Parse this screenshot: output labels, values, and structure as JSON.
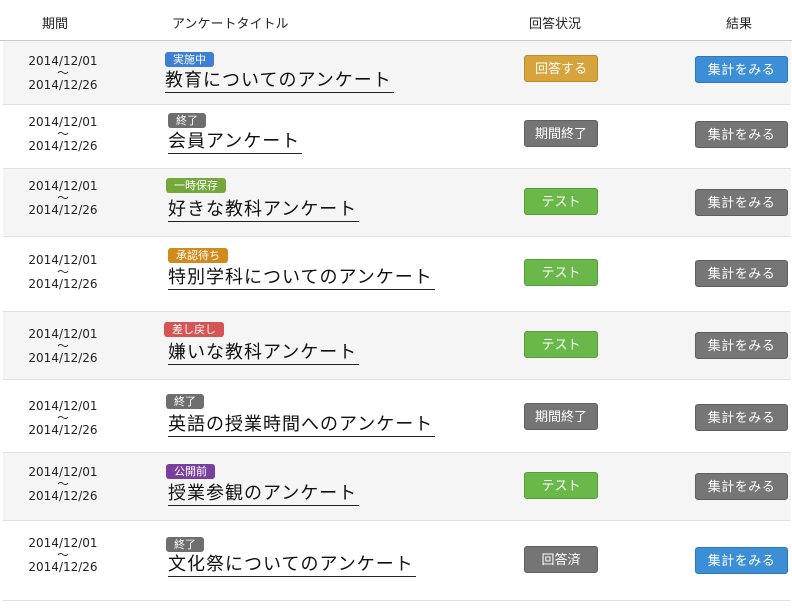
{
  "header": {
    "period": "期間",
    "title": "アンケートタイトル",
    "status": "回答状況",
    "result": "結果"
  },
  "colors": {
    "badge_in_progress": "#3d7fd0",
    "badge_finished": "#6e6e6e",
    "badge_draft": "#74a83a",
    "badge_pending": "#d08a1e",
    "badge_returned": "#d55454",
    "badge_published_before": "#7a3f9e",
    "answer_button": "#d6a33c",
    "test_button": "#6ab84a",
    "closed_button": "#757575",
    "result_active": "#3c8fd6",
    "result_inactive": "#767676"
  },
  "rows": [
    {
      "start": "2014/12/01",
      "tilde": "〜",
      "end": "2014/12/26",
      "badge": "実施中",
      "badge_color": "badge_in_progress",
      "title": "教育についてのアンケート",
      "status": "回答する",
      "status_style": "orange",
      "result": "集計をみる",
      "result_style": "blue"
    },
    {
      "start": "2014/12/01",
      "tilde": "〜",
      "end": "2014/12/26",
      "badge": "終了",
      "badge_color": "badge_finished",
      "title": "会員アンケート",
      "status": "期間終了",
      "status_style": "gray",
      "result": "集計をみる",
      "result_style": "gray"
    },
    {
      "start": "2014/12/01",
      "tilde": "〜",
      "end": "2014/12/26",
      "badge": "一時保存",
      "badge_color": "badge_draft",
      "title": "好きな教科アンケート",
      "status": "テスト",
      "status_style": "green",
      "result": "集計をみる",
      "result_style": "gray"
    },
    {
      "start": "2014/12/01",
      "tilde": "〜",
      "end": "2014/12/26",
      "badge": "承認待ち",
      "badge_color": "badge_pending",
      "title": "特別学科についてのアンケート",
      "status": "テスト",
      "status_style": "green",
      "result": "集計をみる",
      "result_style": "gray"
    },
    {
      "start": "2014/12/01",
      "tilde": "〜",
      "end": "2014/12/26",
      "badge": "差し戻し",
      "badge_color": "badge_returned",
      "title": "嫌いな教科アンケート",
      "status": "テスト",
      "status_style": "green",
      "result": "集計をみる",
      "result_style": "gray"
    },
    {
      "start": "2014/12/01",
      "tilde": "〜",
      "end": "2014/12/26",
      "badge": "終了",
      "badge_color": "badge_finished",
      "title": "英語の授業時間へのアンケート",
      "status": "期間終了",
      "status_style": "gray",
      "result": "集計をみる",
      "result_style": "gray"
    },
    {
      "start": "2014/12/01",
      "tilde": "〜",
      "end": "2014/12/26",
      "badge": "公開前",
      "badge_color": "badge_published_before",
      "title": "授業参観のアンケート",
      "status": "テスト",
      "status_style": "green",
      "result": "集計をみる",
      "result_style": "gray"
    },
    {
      "start": "2014/12/01",
      "tilde": "〜",
      "end": "2014/12/26",
      "badge": "終了",
      "badge_color": "badge_finished",
      "title": "文化祭についてのアンケート",
      "status": "回答済",
      "status_style": "gray",
      "result": "集計をみる",
      "result_style": "blue"
    }
  ]
}
